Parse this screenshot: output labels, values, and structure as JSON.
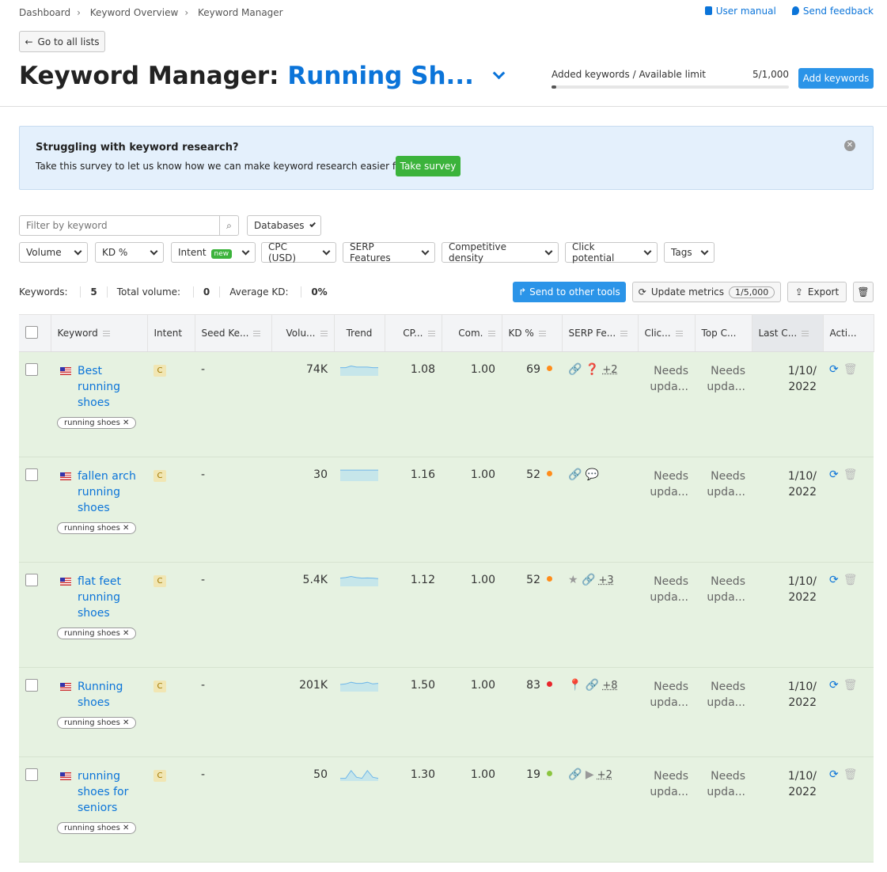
{
  "breadcrumb": [
    "Dashboard",
    "Keyword Overview",
    "Keyword Manager"
  ],
  "top_links": {
    "manual": "User manual",
    "feedback": "Send feedback"
  },
  "go_back": "Go to all lists",
  "title": {
    "prefix": "Keyword Manager:",
    "list_name": "Running Sh..."
  },
  "limit": {
    "label": "Added keywords / Available limit",
    "value": "5/1,000",
    "progress": 0.005
  },
  "add_keywords": "Add keywords",
  "banner": {
    "title": "Struggling with keyword research?",
    "text": "Take this survey to let us know how we can make keyword research easier for you.",
    "button": "Take survey"
  },
  "filter": {
    "placeholder": "Filter by keyword",
    "databases": "Databases"
  },
  "dropdowns": [
    "Volume",
    "KD %",
    "Intent",
    "CPC (USD)",
    "SERP Features",
    "Competitive density",
    "Click potential",
    "Tags"
  ],
  "intent_badge": "new",
  "stats": {
    "keywords": "Keywords: ",
    "keywords_v": "5",
    "volume": "Total volume: ",
    "volume_v": "0",
    "kd": "Average KD: ",
    "kd_v": "0%"
  },
  "actions": {
    "send": "Send to other tools",
    "update": "Update metrics",
    "update_count": "1/5,000",
    "export": "Export"
  },
  "columns": [
    "Keyword",
    "Intent",
    "Seed Ke...",
    "Volu...",
    "Trend",
    "CP...",
    "Com.",
    "KD %",
    "SERP Fe...",
    "Clic...",
    "Top C...",
    "Last C...",
    "Acti..."
  ],
  "colors": {
    "accent": "#0b74d9",
    "button": "#2b94e8",
    "green": "#3bb33b",
    "row_bg": "#e6f2e1"
  },
  "rows": [
    {
      "keyword": "Best running shoes",
      "tag": "running shoes",
      "intent": "C",
      "seed": "-",
      "volume": "74K",
      "trend": [
        0.6,
        0.6,
        0.75,
        0.65,
        0.65,
        0.65,
        0.6,
        0.6
      ],
      "cpc": "1.08",
      "com": "1.00",
      "kd": "69",
      "kd_color": "#ff8c1a",
      "serp": [
        "link",
        "question"
      ],
      "serp_more": "+2",
      "click": "Needs upda...",
      "top": "Needs upda...",
      "last": "1/10/ 2022"
    },
    {
      "keyword": "fallen arch running shoes",
      "tag": "running shoes",
      "intent": "C",
      "seed": "-",
      "volume": "30",
      "trend": [
        0.85,
        0.85,
        0.85,
        0.85,
        0.85,
        0.85,
        0.85,
        0.85
      ],
      "cpc": "1.16",
      "com": "1.00",
      "kd": "52",
      "kd_color": "#ff8c1a",
      "serp": [
        "link",
        "review"
      ],
      "serp_more": "",
      "click": "Needs upda...",
      "top": "Needs upda...",
      "last": "1/10/ 2022"
    },
    {
      "keyword": "flat feet running shoes",
      "tag": "running shoes",
      "intent": "C",
      "seed": "-",
      "volume": "5.4K",
      "trend": [
        0.6,
        0.65,
        0.75,
        0.65,
        0.6,
        0.62,
        0.6,
        0.55
      ],
      "cpc": "1.12",
      "com": "1.00",
      "kd": "52",
      "kd_color": "#ff8c1a",
      "serp": [
        "star",
        "link"
      ],
      "serp_more": "+3",
      "click": "Needs upda...",
      "top": "Needs upda...",
      "last": "1/10/ 2022"
    },
    {
      "keyword": "Running shoes",
      "tag": "running shoes",
      "intent": "C",
      "seed": "-",
      "volume": "201K",
      "trend": [
        0.5,
        0.55,
        0.7,
        0.6,
        0.6,
        0.7,
        0.55,
        0.6
      ],
      "cpc": "1.50",
      "com": "1.00",
      "kd": "83",
      "kd_color": "#e8262b",
      "serp": [
        "pin",
        "link"
      ],
      "serp_more": "+8",
      "click": "Needs upda...",
      "top": "Needs upda...",
      "last": "1/10/ 2022"
    },
    {
      "keyword": "running shoes for seniors",
      "tag": "running shoes",
      "intent": "C",
      "seed": "-",
      "volume": "50",
      "trend": [
        0.1,
        0.1,
        0.8,
        0.2,
        0.1,
        0.8,
        0.2,
        0.1
      ],
      "cpc": "1.30",
      "com": "1.00",
      "kd": "19",
      "kd_color": "#8bc53f",
      "serp": [
        "link",
        "video"
      ],
      "serp_more": "+2",
      "click": "Needs upda...",
      "top": "Needs upda...",
      "last": "1/10/ 2022"
    }
  ]
}
